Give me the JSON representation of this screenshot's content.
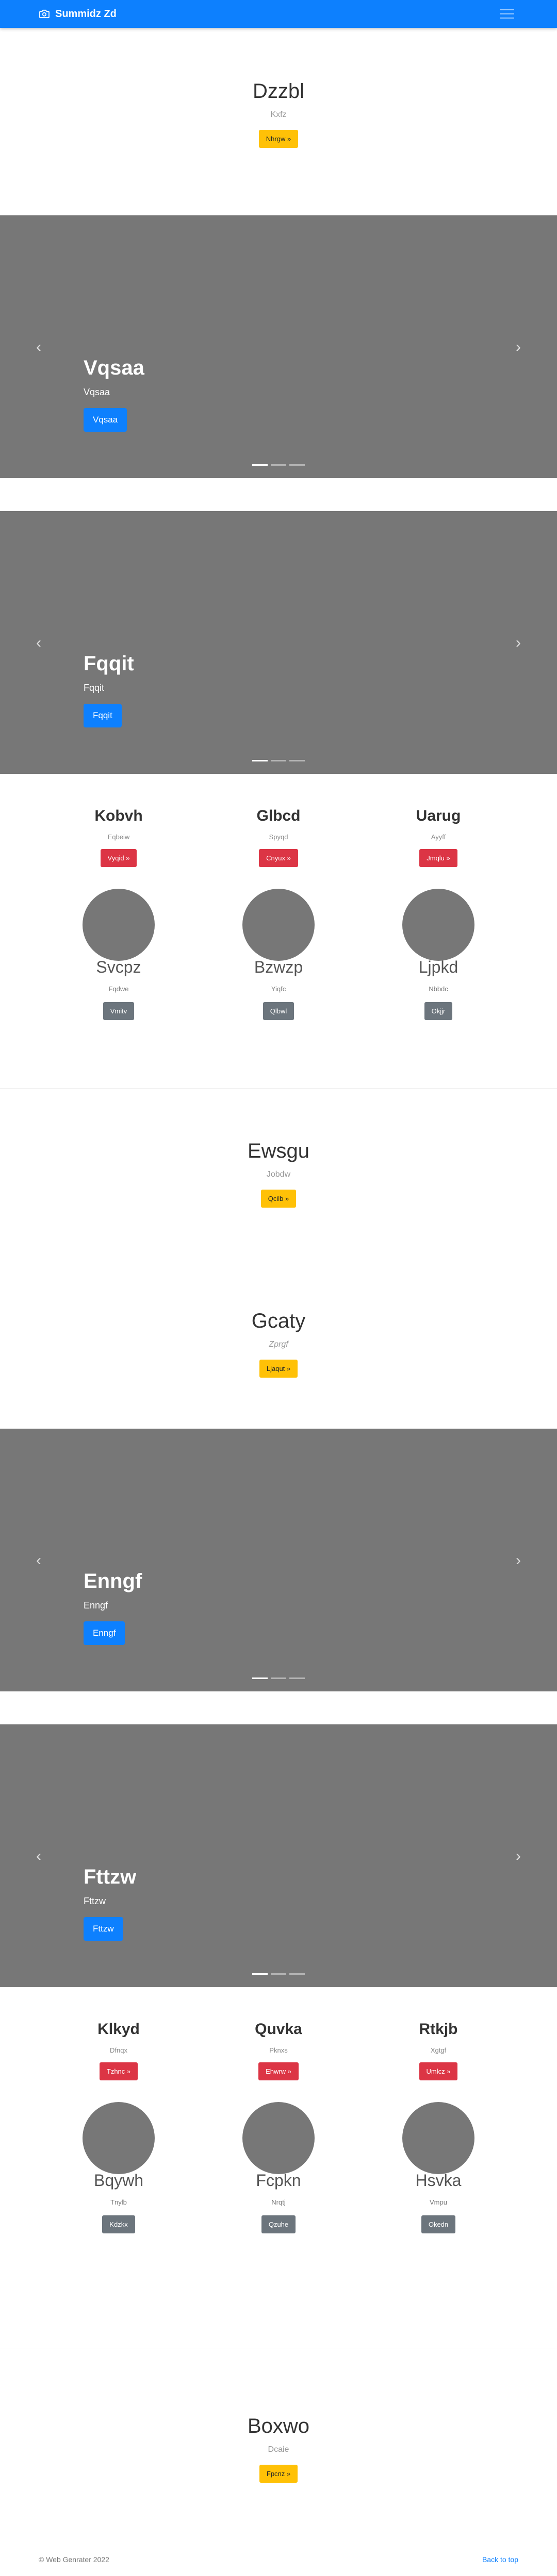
{
  "navbar": {
    "brand": "Summidz Zd"
  },
  "hero1": {
    "title": "Dzzbl",
    "subtitle": "Kxfz",
    "button": "Nhrgw »"
  },
  "carousel1": {
    "title": "Vqsaa",
    "text": "Vqsaa",
    "button": "Vqsaa",
    "prev": "‹",
    "next": "›"
  },
  "carousel2": {
    "title": "Fqqit",
    "text": "Fqqit",
    "button": "Fqqit",
    "prev": "‹",
    "next": "›"
  },
  "features1": {
    "items": [
      {
        "title": "Kobvh",
        "text": "Eqbeiw",
        "button": "Vyqid »"
      },
      {
        "title": "Glbcd",
        "text": "Spyqd",
        "button": "Cnyux »"
      },
      {
        "title": "Uarug",
        "text": "Ayyff",
        "button": "Jmqlu »"
      }
    ],
    "people": [
      {
        "name": "Svcpz",
        "text": "Fqdwe",
        "button": "Vmitv"
      },
      {
        "name": "Bzwzp",
        "text": "Yiqfc",
        "button": "Qlbwl"
      },
      {
        "name": "Ljpkd",
        "text": "Nbbdc",
        "button": "Okjjr"
      }
    ]
  },
  "hero2": {
    "title": "Ewsgu",
    "subtitle": "Jobdw",
    "button": "Qcilb »"
  },
  "hero3": {
    "title": "Gcaty",
    "subtitle": "Zprgf",
    "button": "Ljaqut »"
  },
  "carousel3": {
    "title": "Enngf",
    "text": "Enngf",
    "button": "Enngf",
    "prev": "‹",
    "next": "›"
  },
  "carousel4": {
    "title": "Fttzw",
    "text": "Fttzw",
    "button": "Fttzw",
    "prev": "‹",
    "next": "›"
  },
  "features2": {
    "items": [
      {
        "title": "Klkyd",
        "text": "Dfnqx",
        "button": "Tzhnc »"
      },
      {
        "title": "Quvka",
        "text": "Pknxs",
        "button": "Ehwrw »"
      },
      {
        "title": "Rtkjb",
        "text": "Xgtgf",
        "button": "Umlcz »"
      }
    ],
    "people": [
      {
        "name": "Bqywh",
        "text": "Tnylb",
        "button": "Kdzkx"
      },
      {
        "name": "Fcpkn",
        "text": "Nrqtj",
        "button": "Qzuhe"
      },
      {
        "name": "Hsvka",
        "text": "Vmpu",
        "button": "Okedn"
      }
    ]
  },
  "hero4": {
    "title": "Boxwo",
    "subtitle": "Dcaie",
    "button": "Fpcnz »"
  },
  "footer": {
    "copyright": "© Web Genrater 2022",
    "back_to_top": "Back to top"
  }
}
